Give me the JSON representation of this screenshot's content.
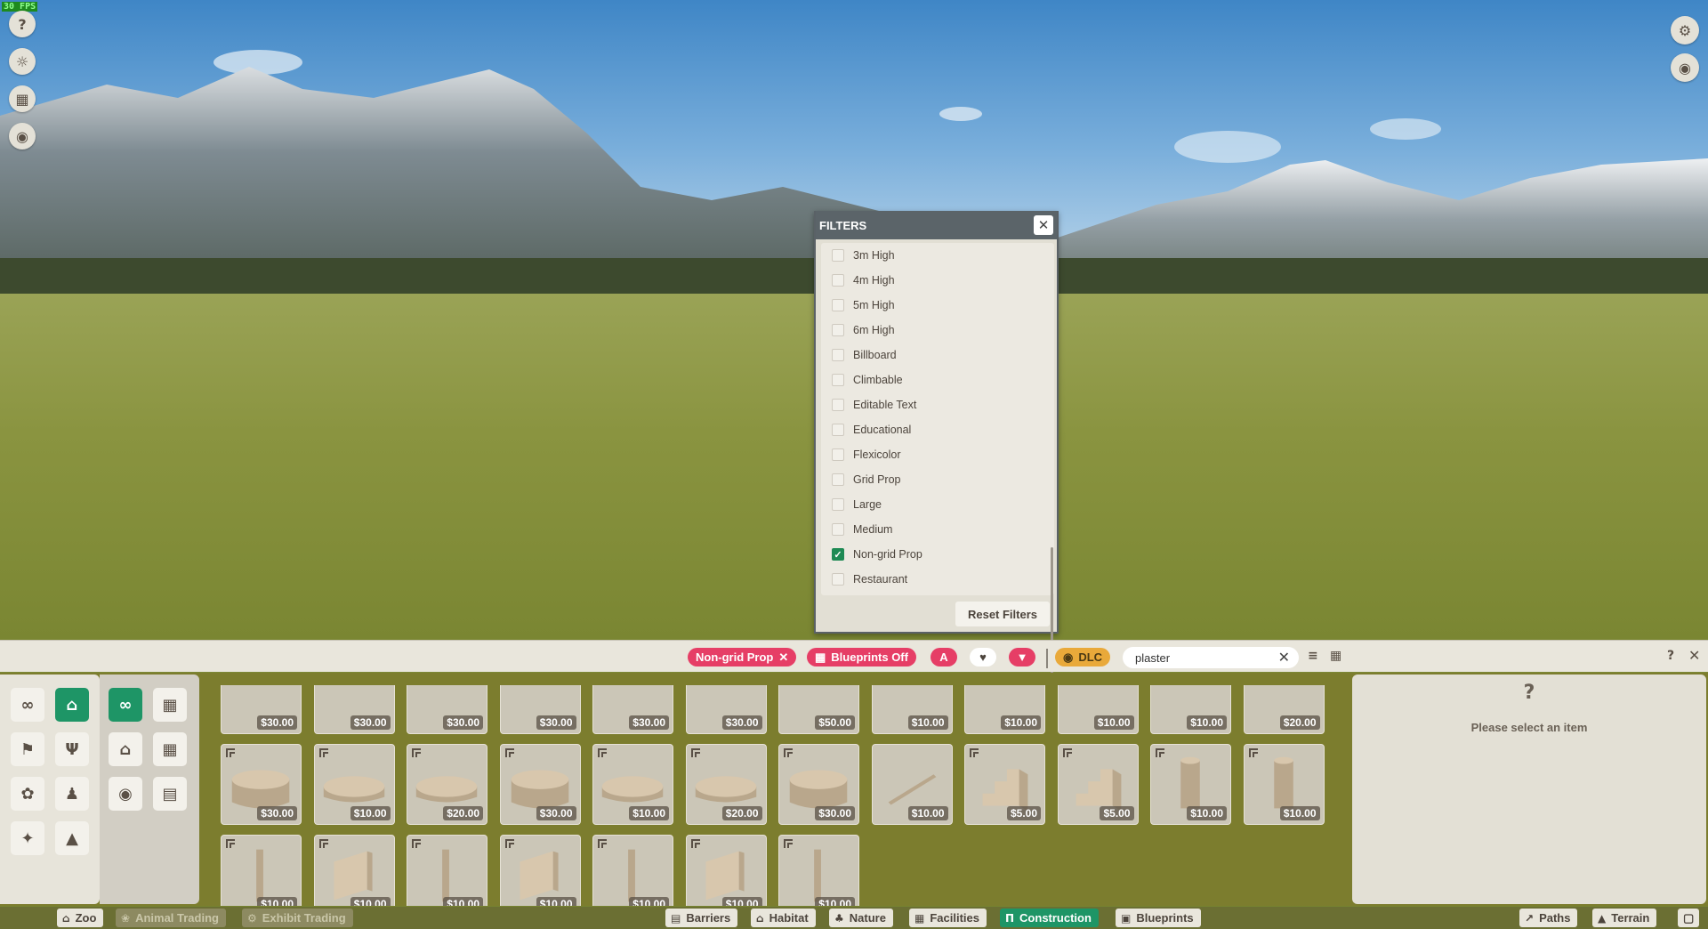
{
  "hud": {
    "fps": "30 FPS",
    "left_icons": [
      "help-icon",
      "zoo-info-icon",
      "calendar-icon",
      "visibility-icon"
    ],
    "right_icons": [
      "settings-icon",
      "camera-icon"
    ]
  },
  "filters": {
    "title": "FILTERS",
    "close_icon": "close-icon",
    "options": [
      {
        "label": "3m High",
        "checked": false
      },
      {
        "label": "4m High",
        "checked": false
      },
      {
        "label": "5m High",
        "checked": false
      },
      {
        "label": "6m High",
        "checked": false
      },
      {
        "label": "Billboard",
        "checked": false
      },
      {
        "label": "Climbable",
        "checked": false
      },
      {
        "label": "Editable Text",
        "checked": false
      },
      {
        "label": "Educational",
        "checked": false
      },
      {
        "label": "Flexicolor",
        "checked": false
      },
      {
        "label": "Grid Prop",
        "checked": false
      },
      {
        "label": "Large",
        "checked": false
      },
      {
        "label": "Medium",
        "checked": false
      },
      {
        "label": "Non-grid Prop",
        "checked": true
      },
      {
        "label": "Restaurant",
        "checked": false
      }
    ],
    "reset_label": "Reset Filters"
  },
  "toolbar": {
    "active_filter": "Non-grid Prop",
    "blueprints_toggle": "Blueprints Off",
    "dlc_label": "DLC",
    "search_value": "plaster",
    "colors": {
      "chip": "#e63e66",
      "dlc": "#e9a93a",
      "selected": "#1e9566"
    }
  },
  "items": {
    "row1": [
      "$30.00",
      "$30.00",
      "$30.00",
      "$30.00",
      "$30.00",
      "$30.00",
      "$50.00",
      "$10.00",
      "$10.00",
      "$10.00",
      "$10.00",
      "$20.00"
    ],
    "row2": [
      "$30.00",
      "$10.00",
      "$20.00",
      "$30.00",
      "$10.00",
      "$20.00",
      "$30.00",
      "$10.00",
      "$5.00",
      "$5.00",
      "$10.00",
      "$10.00"
    ],
    "row3": [
      "$10.00",
      "$10.00",
      "$10.00",
      "$10.00",
      "$10.00",
      "$10.00",
      "$10.00"
    ]
  },
  "info": {
    "placeholder_icon": "?",
    "message": "Please select an item"
  },
  "nav": {
    "left": [
      {
        "label": "Zoo",
        "icon": "zoo-icon",
        "state": "normal"
      },
      {
        "label": "Animal Trading",
        "icon": "paw-icon",
        "state": "disabled"
      },
      {
        "label": "Exhibit Trading",
        "icon": "gear-icon",
        "state": "disabled"
      }
    ],
    "center": [
      {
        "label": "Barriers",
        "icon": "barrier-icon",
        "state": "normal"
      },
      {
        "label": "Habitat",
        "icon": "habitat-icon",
        "state": "normal"
      },
      {
        "label": "Nature",
        "icon": "tree-icon",
        "state": "normal"
      },
      {
        "label": "Facilities",
        "icon": "building-icon",
        "state": "normal"
      },
      {
        "label": "Construction",
        "icon": "construction-icon",
        "state": "selected"
      },
      {
        "label": "Blueprints",
        "icon": "blueprint-icon",
        "state": "normal"
      }
    ],
    "right": [
      {
        "label": "Paths",
        "icon": "path-icon",
        "state": "normal"
      },
      {
        "label": "Terrain",
        "icon": "terrain-icon",
        "state": "normal"
      }
    ]
  }
}
